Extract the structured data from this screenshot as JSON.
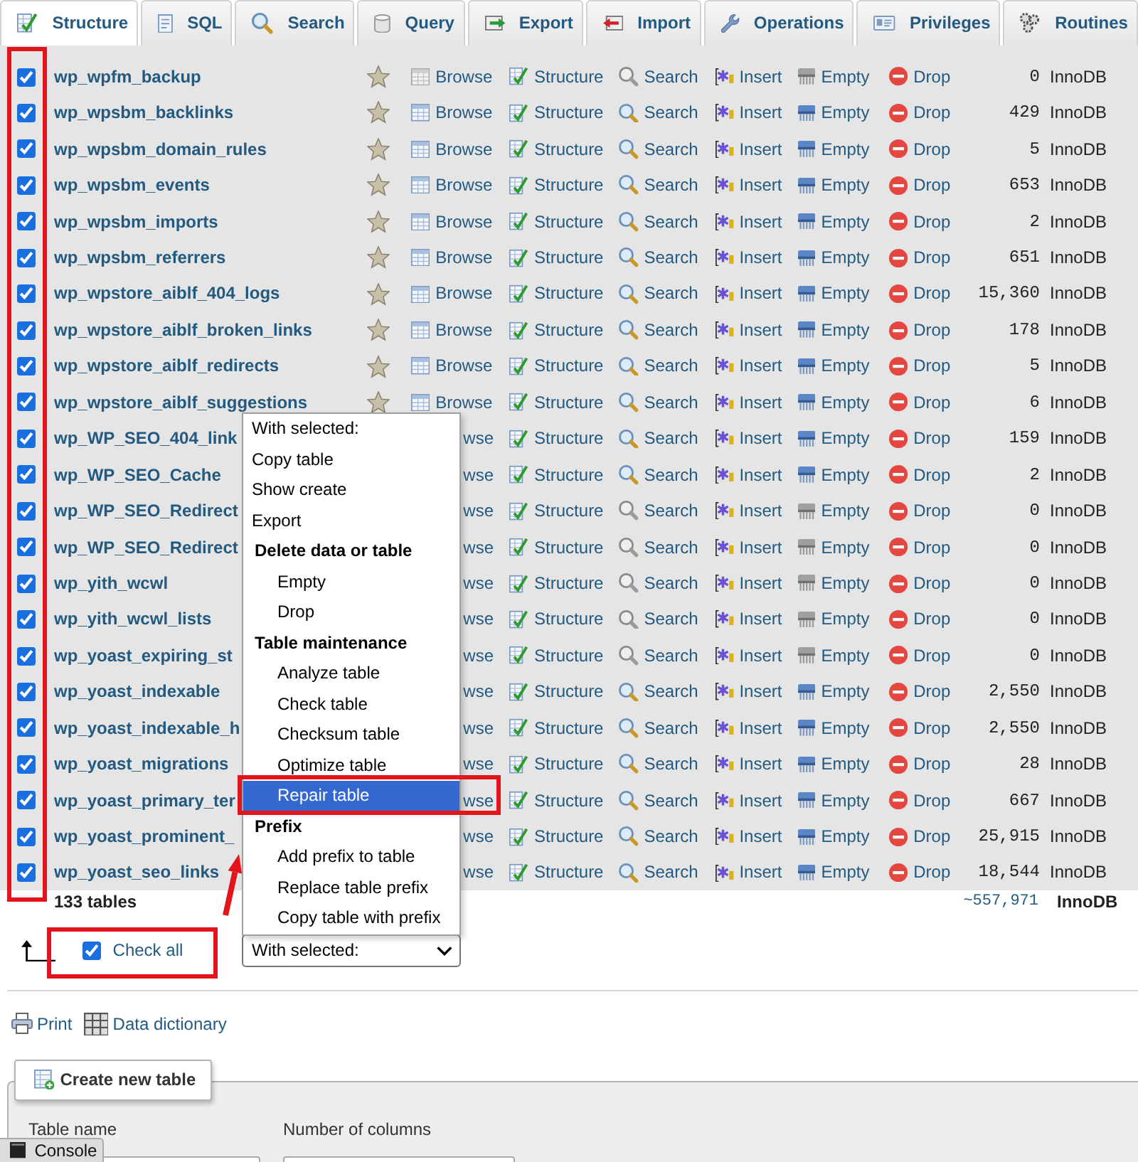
{
  "tabs": [
    {
      "kind": "structure",
      "label": "Structure",
      "selected": true
    },
    {
      "kind": "sql",
      "label": "SQL",
      "selected": false
    },
    {
      "kind": "search",
      "label": "Search",
      "selected": false
    },
    {
      "kind": "query",
      "label": "Query",
      "selected": false
    },
    {
      "kind": "export",
      "label": "Export",
      "selected": false
    },
    {
      "kind": "import",
      "label": "Import",
      "selected": false
    },
    {
      "kind": "operations",
      "label": "Operations",
      "selected": false
    },
    {
      "kind": "privileges",
      "label": "Privileges",
      "selected": false
    },
    {
      "kind": "routines",
      "label": "Routines",
      "selected": false
    }
  ],
  "table": {
    "marked": true,
    "rows": [
      {
        "checked": true,
        "name": "wp_wpfm_backup",
        "no_rows": true,
        "under_menu": false,
        "actions": [
          {
            "kind": "browse",
            "label": "Browse"
          },
          {
            "kind": "structure",
            "label": "Structure"
          },
          {
            "kind": "search",
            "label": "Search"
          },
          {
            "kind": "insert",
            "label": "Insert"
          },
          {
            "kind": "empty",
            "label": "Empty"
          },
          {
            "kind": "drop",
            "label": "Drop"
          }
        ],
        "count": "0",
        "engine": "InnoDB"
      },
      {
        "checked": true,
        "name": "wp_wpsbm_backlinks",
        "no_rows": false,
        "under_menu": false,
        "actions": [
          {
            "kind": "browse",
            "label": "Browse"
          },
          {
            "kind": "structure",
            "label": "Structure"
          },
          {
            "kind": "search",
            "label": "Search"
          },
          {
            "kind": "insert",
            "label": "Insert"
          },
          {
            "kind": "empty",
            "label": "Empty"
          },
          {
            "kind": "drop",
            "label": "Drop"
          }
        ],
        "count": "429",
        "engine": "InnoDB"
      },
      {
        "checked": true,
        "name": "wp_wpsbm_domain_rules",
        "no_rows": false,
        "under_menu": false,
        "actions": [
          {
            "kind": "browse",
            "label": "Browse"
          },
          {
            "kind": "structure",
            "label": "Structure"
          },
          {
            "kind": "search",
            "label": "Search"
          },
          {
            "kind": "insert",
            "label": "Insert"
          },
          {
            "kind": "empty",
            "label": "Empty"
          },
          {
            "kind": "drop",
            "label": "Drop"
          }
        ],
        "count": "5",
        "engine": "InnoDB"
      },
      {
        "checked": true,
        "name": "wp_wpsbm_events",
        "no_rows": false,
        "under_menu": false,
        "actions": [
          {
            "kind": "browse",
            "label": "Browse"
          },
          {
            "kind": "structure",
            "label": "Structure"
          },
          {
            "kind": "search",
            "label": "Search"
          },
          {
            "kind": "insert",
            "label": "Insert"
          },
          {
            "kind": "empty",
            "label": "Empty"
          },
          {
            "kind": "drop",
            "label": "Drop"
          }
        ],
        "count": "653",
        "engine": "InnoDB"
      },
      {
        "checked": true,
        "name": "wp_wpsbm_imports",
        "no_rows": false,
        "under_menu": false,
        "actions": [
          {
            "kind": "browse",
            "label": "Browse"
          },
          {
            "kind": "structure",
            "label": "Structure"
          },
          {
            "kind": "search",
            "label": "Search"
          },
          {
            "kind": "insert",
            "label": "Insert"
          },
          {
            "kind": "empty",
            "label": "Empty"
          },
          {
            "kind": "drop",
            "label": "Drop"
          }
        ],
        "count": "2",
        "engine": "InnoDB"
      },
      {
        "checked": true,
        "name": "wp_wpsbm_referrers",
        "no_rows": false,
        "under_menu": false,
        "actions": [
          {
            "kind": "browse",
            "label": "Browse"
          },
          {
            "kind": "structure",
            "label": "Structure"
          },
          {
            "kind": "search",
            "label": "Search"
          },
          {
            "kind": "insert",
            "label": "Insert"
          },
          {
            "kind": "empty",
            "label": "Empty"
          },
          {
            "kind": "drop",
            "label": "Drop"
          }
        ],
        "count": "651",
        "engine": "InnoDB"
      },
      {
        "checked": true,
        "name": "wp_wpstore_aiblf_404_logs",
        "no_rows": false,
        "under_menu": false,
        "actions": [
          {
            "kind": "browse",
            "label": "Browse"
          },
          {
            "kind": "structure",
            "label": "Structure"
          },
          {
            "kind": "search",
            "label": "Search"
          },
          {
            "kind": "insert",
            "label": "Insert"
          },
          {
            "kind": "empty",
            "label": "Empty"
          },
          {
            "kind": "drop",
            "label": "Drop"
          }
        ],
        "count": "15,360",
        "engine": "InnoDB"
      },
      {
        "checked": true,
        "name": "wp_wpstore_aiblf_broken_links",
        "no_rows": false,
        "under_menu": false,
        "actions": [
          {
            "kind": "browse",
            "label": "Browse"
          },
          {
            "kind": "structure",
            "label": "Structure"
          },
          {
            "kind": "search",
            "label": "Search"
          },
          {
            "kind": "insert",
            "label": "Insert"
          },
          {
            "kind": "empty",
            "label": "Empty"
          },
          {
            "kind": "drop",
            "label": "Drop"
          }
        ],
        "count": "178",
        "engine": "InnoDB"
      },
      {
        "checked": true,
        "name": "wp_wpstore_aiblf_redirects",
        "no_rows": false,
        "under_menu": false,
        "actions": [
          {
            "kind": "browse",
            "label": "Browse"
          },
          {
            "kind": "structure",
            "label": "Structure"
          },
          {
            "kind": "search",
            "label": "Search"
          },
          {
            "kind": "insert",
            "label": "Insert"
          },
          {
            "kind": "empty",
            "label": "Empty"
          },
          {
            "kind": "drop",
            "label": "Drop"
          }
        ],
        "count": "5",
        "engine": "InnoDB"
      },
      {
        "checked": true,
        "name": "wp_wpstore_aiblf_suggestions",
        "no_rows": false,
        "under_menu": false,
        "actions": [
          {
            "kind": "browse",
            "label": "Browse"
          },
          {
            "kind": "structure",
            "label": "Structure"
          },
          {
            "kind": "search",
            "label": "Search"
          },
          {
            "kind": "insert",
            "label": "Insert"
          },
          {
            "kind": "empty",
            "label": "Empty"
          },
          {
            "kind": "drop",
            "label": "Drop"
          }
        ],
        "count": "6",
        "engine": "InnoDB"
      },
      {
        "checked": true,
        "name": "wp_WP_SEO_404_link",
        "no_rows": false,
        "under_menu": true,
        "actions": [
          {
            "kind": "browse",
            "label": "wse"
          },
          {
            "kind": "structure",
            "label": "Structure"
          },
          {
            "kind": "search",
            "label": "Search"
          },
          {
            "kind": "insert",
            "label": "Insert"
          },
          {
            "kind": "empty",
            "label": "Empty"
          },
          {
            "kind": "drop",
            "label": "Drop"
          }
        ],
        "count": "159",
        "engine": "InnoDB"
      },
      {
        "checked": true,
        "name": "wp_WP_SEO_Cache",
        "no_rows": false,
        "under_menu": true,
        "actions": [
          {
            "kind": "browse",
            "label": "wse"
          },
          {
            "kind": "structure",
            "label": "Structure"
          },
          {
            "kind": "search",
            "label": "Search"
          },
          {
            "kind": "insert",
            "label": "Insert"
          },
          {
            "kind": "empty",
            "label": "Empty"
          },
          {
            "kind": "drop",
            "label": "Drop"
          }
        ],
        "count": "2",
        "engine": "InnoDB"
      },
      {
        "checked": true,
        "name": "wp_WP_SEO_Redirect",
        "no_rows": true,
        "under_menu": true,
        "actions": [
          {
            "kind": "browse",
            "label": "wse"
          },
          {
            "kind": "structure",
            "label": "Structure"
          },
          {
            "kind": "search",
            "label": "Search"
          },
          {
            "kind": "insert",
            "label": "Insert"
          },
          {
            "kind": "empty",
            "label": "Empty"
          },
          {
            "kind": "drop",
            "label": "Drop"
          }
        ],
        "count": "0",
        "engine": "InnoDB"
      },
      {
        "checked": true,
        "name": "wp_WP_SEO_Redirect",
        "no_rows": true,
        "under_menu": true,
        "actions": [
          {
            "kind": "browse",
            "label": "wse"
          },
          {
            "kind": "structure",
            "label": "Structure"
          },
          {
            "kind": "search",
            "label": "Search"
          },
          {
            "kind": "insert",
            "label": "Insert"
          },
          {
            "kind": "empty",
            "label": "Empty"
          },
          {
            "kind": "drop",
            "label": "Drop"
          }
        ],
        "count": "0",
        "engine": "InnoDB"
      },
      {
        "checked": true,
        "name": "wp_yith_wcwl",
        "no_rows": true,
        "under_menu": true,
        "actions": [
          {
            "kind": "browse",
            "label": "wse"
          },
          {
            "kind": "structure",
            "label": "Structure"
          },
          {
            "kind": "search",
            "label": "Search"
          },
          {
            "kind": "insert",
            "label": "Insert"
          },
          {
            "kind": "empty",
            "label": "Empty"
          },
          {
            "kind": "drop",
            "label": "Drop"
          }
        ],
        "count": "0",
        "engine": "InnoDB"
      },
      {
        "checked": true,
        "name": "wp_yith_wcwl_lists",
        "no_rows": true,
        "under_menu": true,
        "actions": [
          {
            "kind": "browse",
            "label": "wse"
          },
          {
            "kind": "structure",
            "label": "Structure"
          },
          {
            "kind": "search",
            "label": "Search"
          },
          {
            "kind": "insert",
            "label": "Insert"
          },
          {
            "kind": "empty",
            "label": "Empty"
          },
          {
            "kind": "drop",
            "label": "Drop"
          }
        ],
        "count": "0",
        "engine": "InnoDB"
      },
      {
        "checked": true,
        "name": "wp_yoast_expiring_st",
        "no_rows": true,
        "under_menu": true,
        "actions": [
          {
            "kind": "browse",
            "label": "wse"
          },
          {
            "kind": "structure",
            "label": "Structure"
          },
          {
            "kind": "search",
            "label": "Search"
          },
          {
            "kind": "insert",
            "label": "Insert"
          },
          {
            "kind": "empty",
            "label": "Empty"
          },
          {
            "kind": "drop",
            "label": "Drop"
          }
        ],
        "count": "0",
        "engine": "InnoDB"
      },
      {
        "checked": true,
        "name": "wp_yoast_indexable",
        "no_rows": false,
        "under_menu": true,
        "actions": [
          {
            "kind": "browse",
            "label": "wse"
          },
          {
            "kind": "structure",
            "label": "Structure"
          },
          {
            "kind": "search",
            "label": "Search"
          },
          {
            "kind": "insert",
            "label": "Insert"
          },
          {
            "kind": "empty",
            "label": "Empty"
          },
          {
            "kind": "drop",
            "label": "Drop"
          }
        ],
        "count": "2,550",
        "engine": "InnoDB"
      },
      {
        "checked": true,
        "name": "wp_yoast_indexable_h",
        "no_rows": false,
        "under_menu": true,
        "actions": [
          {
            "kind": "browse",
            "label": "wse"
          },
          {
            "kind": "structure",
            "label": "Structure"
          },
          {
            "kind": "search",
            "label": "Search"
          },
          {
            "kind": "insert",
            "label": "Insert"
          },
          {
            "kind": "empty",
            "label": "Empty"
          },
          {
            "kind": "drop",
            "label": "Drop"
          }
        ],
        "count": "2,550",
        "engine": "InnoDB"
      },
      {
        "checked": true,
        "name": "wp_yoast_migrations",
        "no_rows": false,
        "under_menu": true,
        "actions": [
          {
            "kind": "browse",
            "label": "wse"
          },
          {
            "kind": "structure",
            "label": "Structure"
          },
          {
            "kind": "search",
            "label": "Search"
          },
          {
            "kind": "insert",
            "label": "Insert"
          },
          {
            "kind": "empty",
            "label": "Empty"
          },
          {
            "kind": "drop",
            "label": "Drop"
          }
        ],
        "count": "28",
        "engine": "InnoDB"
      },
      {
        "checked": true,
        "name": "wp_yoast_primary_ter",
        "no_rows": false,
        "under_menu": true,
        "actions": [
          {
            "kind": "browse",
            "label": "wse"
          },
          {
            "kind": "structure",
            "label": "Structure"
          },
          {
            "kind": "search",
            "label": "Search"
          },
          {
            "kind": "insert",
            "label": "Insert"
          },
          {
            "kind": "empty",
            "label": "Empty"
          },
          {
            "kind": "drop",
            "label": "Drop"
          }
        ],
        "count": "667",
        "engine": "InnoDB"
      },
      {
        "checked": true,
        "name": "wp_yoast_prominent_",
        "no_rows": false,
        "under_menu": true,
        "actions": [
          {
            "kind": "browse",
            "label": "wse"
          },
          {
            "kind": "structure",
            "label": "Structure"
          },
          {
            "kind": "search",
            "label": "Search"
          },
          {
            "kind": "insert",
            "label": "Insert"
          },
          {
            "kind": "empty",
            "label": "Empty"
          },
          {
            "kind": "drop",
            "label": "Drop"
          }
        ],
        "count": "25,915",
        "engine": "InnoDB"
      },
      {
        "checked": true,
        "name": "wp_yoast_seo_links",
        "no_rows": false,
        "under_menu": true,
        "actions": [
          {
            "kind": "browse",
            "label": "wse"
          },
          {
            "kind": "structure",
            "label": "Structure"
          },
          {
            "kind": "search",
            "label": "Search"
          },
          {
            "kind": "insert",
            "label": "Insert"
          },
          {
            "kind": "empty",
            "label": "Empty"
          },
          {
            "kind": "drop",
            "label": "Drop"
          }
        ],
        "count": "18,544",
        "engine": "InnoDB"
      }
    ],
    "summary": {
      "tables": "133 tables",
      "rows": "~557,971",
      "engine": "InnoDB"
    }
  },
  "check_all": {
    "label": "Check all",
    "checked": true,
    "marked": true
  },
  "select": {
    "value": "With selected:"
  },
  "menu": {
    "arrow": true,
    "items": [
      {
        "kind": "option",
        "label": "With selected:",
        "selected": false
      },
      {
        "kind": "option",
        "label": "Copy table",
        "selected": false
      },
      {
        "kind": "option",
        "label": "Show create",
        "selected": false
      },
      {
        "kind": "option",
        "label": "Export",
        "selected": false
      },
      {
        "kind": "group",
        "label": "Delete data or table",
        "children": [
          {
            "label": "Empty",
            "selected": false
          },
          {
            "label": "Drop",
            "selected": false
          }
        ]
      },
      {
        "kind": "group",
        "label": "Table maintenance",
        "children": [
          {
            "label": "Analyze table",
            "selected": false
          },
          {
            "label": "Check table",
            "selected": false
          },
          {
            "label": "Checksum table",
            "selected": false
          },
          {
            "label": "Optimize table",
            "selected": false
          },
          {
            "label": "Repair table",
            "selected": true,
            "marked": true
          }
        ]
      },
      {
        "kind": "group",
        "label": "Prefix",
        "children": [
          {
            "label": "Add prefix to table",
            "selected": false
          },
          {
            "label": "Replace table prefix",
            "selected": false
          },
          {
            "label": "Copy table with prefix",
            "selected": false
          }
        ]
      }
    ]
  },
  "links": [
    {
      "kind": "print",
      "label": "Print"
    },
    {
      "kind": "dictionary",
      "label": "Data dictionary"
    }
  ],
  "create_table": {
    "legend": "Create new table",
    "fields": [
      {
        "label": "Table name"
      },
      {
        "label": "Number of columns"
      }
    ]
  },
  "console": {
    "label": "Console"
  }
}
